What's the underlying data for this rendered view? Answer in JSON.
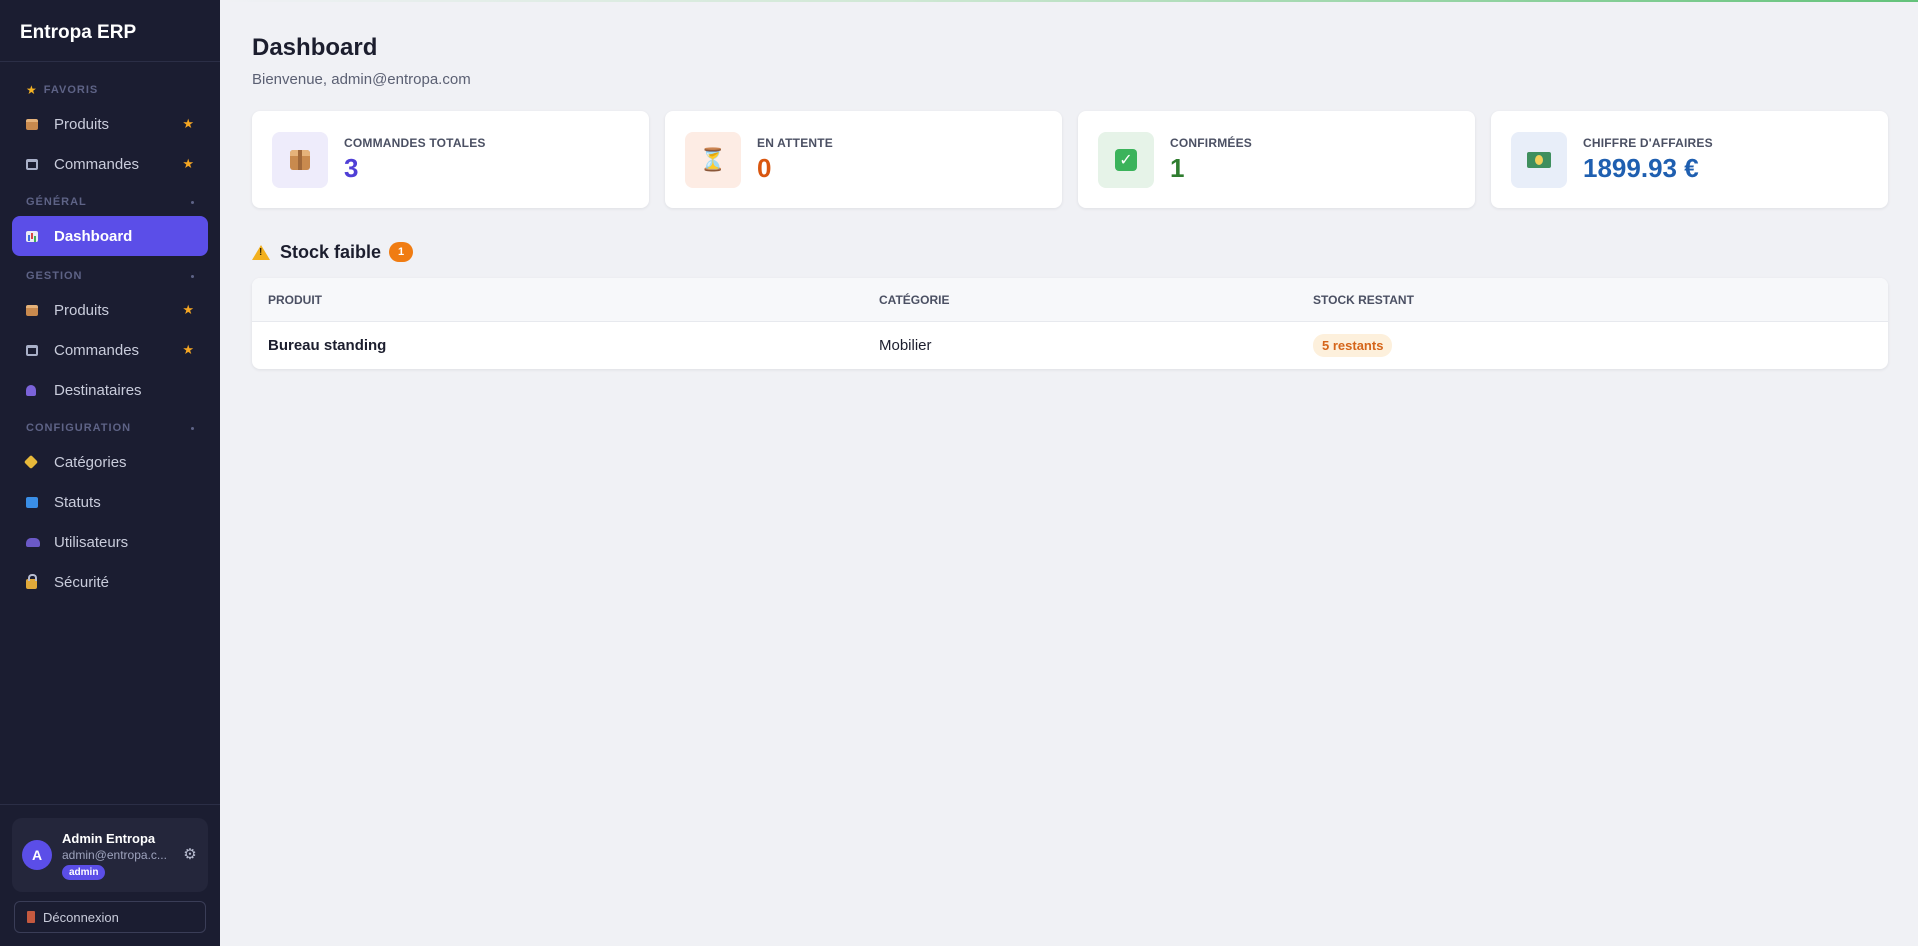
{
  "app": {
    "title": "Entropa ERP"
  },
  "sidebar": {
    "favorites": {
      "heading": "FAVORIS",
      "items": [
        {
          "label": "Produits",
          "icon": "package-icon",
          "starred": true
        },
        {
          "label": "Commandes",
          "icon": "cart-icon",
          "starred": true
        }
      ]
    },
    "general": {
      "heading": "GÉNÉRAL",
      "items": [
        {
          "label": "Dashboard",
          "icon": "chart-icon",
          "active": true
        }
      ]
    },
    "gestion": {
      "heading": "GESTION",
      "items": [
        {
          "label": "Produits",
          "icon": "package-icon",
          "starred": true
        },
        {
          "label": "Commandes",
          "icon": "cart-icon",
          "starred": true
        },
        {
          "label": "Destinataires",
          "icon": "person-icon"
        }
      ]
    },
    "configuration": {
      "heading": "CONFIGURATION",
      "items": [
        {
          "label": "Catégories",
          "icon": "tag-icon"
        },
        {
          "label": "Statuts",
          "icon": "sync-icon"
        },
        {
          "label": "Utilisateurs",
          "icon": "users-icon"
        },
        {
          "label": "Sécurité",
          "icon": "lock-icon"
        }
      ]
    },
    "star_glyph": "★",
    "user": {
      "initial": "A",
      "name": "Admin Entropa",
      "email": "admin@entropa.c...",
      "role": "admin"
    },
    "logout_label": "Déconnexion"
  },
  "main": {
    "title": "Dashboard",
    "subtitle": "Bienvenue, admin@entropa.com",
    "stats": [
      {
        "label": "COMMANDES TOTALES",
        "value": "3",
        "icon": "package-icon",
        "color": "#4f3fd6",
        "bg": "#eeecfb"
      },
      {
        "label": "EN ATTENTE",
        "value": "0",
        "icon": "hourglass-icon",
        "color": "#d9560f",
        "bg": "#fdecE4"
      },
      {
        "label": "CONFIRMÉES",
        "value": "1",
        "icon": "check-icon",
        "color": "#2f7d2f",
        "bg": "#e6f3e8"
      },
      {
        "label": "CHIFFRE D'AFFAIRES",
        "value": "1899.93 €",
        "icon": "money-icon",
        "color": "#1f5fb0",
        "bg": "#e8eef9"
      }
    ],
    "low_stock": {
      "title": "Stock faible",
      "count": "1",
      "columns": [
        "PRODUIT",
        "CATÉGORIE",
        "STOCK RESTANT"
      ],
      "rows": [
        {
          "product": "Bureau standing",
          "category": "Mobilier",
          "stock": "5 restants"
        }
      ]
    }
  }
}
